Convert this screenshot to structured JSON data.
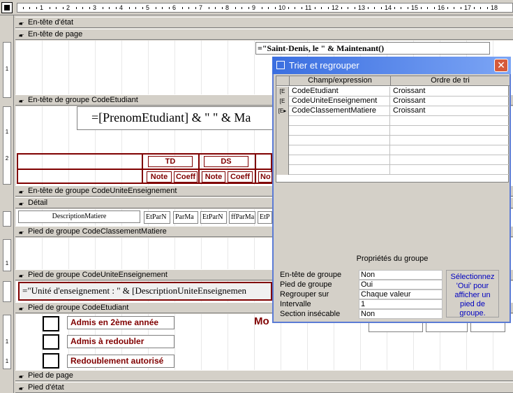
{
  "ruler": {
    "numbers": [
      "1",
      "2",
      "3",
      "4",
      "5",
      "6",
      "7",
      "8",
      "9",
      "10",
      "11",
      "12",
      "13",
      "14",
      "15",
      "16",
      "17",
      "18"
    ]
  },
  "vruler": {
    "marks": [
      "1",
      "1",
      "2",
      "1",
      "1",
      "1"
    ]
  },
  "sections": {
    "report_header": "En-tête d'état",
    "page_header": "En-tête de page",
    "group_header_etudiant": "En-tête de groupe CodeEtudiant",
    "group_header_ue": "En-tête de groupe CodeUniteEnseignement",
    "detail": "Détail",
    "group_footer_classement": "Pied de groupe CodeClassementMatiere",
    "group_footer_ue": "Pied de groupe CodeUniteEnseignement",
    "group_footer_etudiant": "Pied de groupe CodeEtudiant",
    "page_footer": "Pied de page",
    "report_footer": "Pied d'état"
  },
  "controls": {
    "date_expr": "=\"Saint-Denis, le \" & Maintenant()",
    "name_expr": "=[PrenomEtudiant] & \" \" & Ma",
    "td_label": "TD",
    "ds_label": "DS",
    "note1": "Note",
    "coeff1": "Coeff",
    "note2": "Note",
    "coeff2": "Coeff",
    "note3": "No",
    "desc_matiere": "DescriptionMatiere",
    "etpar1": "EtParN",
    "parma1": "ParMa",
    "etpar2": "EtParN",
    "ffparma": "ffParMa",
    "etp3": "EtP",
    "ue_expr": "=\"Unité d'enseignement : \" & [DescriptionUniteEnseignemen",
    "admis2": "Admis en 2ème année",
    "redoubler": "Admis à redoubler",
    "redoublement": "Redoublement autorisé",
    "moy": "Mo"
  },
  "dialog": {
    "title": "Trier et regrouper",
    "close": "✕",
    "col_field": "Champ/expression",
    "col_order": "Ordre de tri",
    "rows": [
      {
        "field": "CodeEtudiant",
        "order": "Croissant"
      },
      {
        "field": "CodeUniteEnseignement",
        "order": "Croissant"
      },
      {
        "field": "CodeClassementMatiere",
        "order": "Croissant"
      }
    ],
    "props_title": "Propriétés du groupe",
    "props": [
      {
        "label": "En-tête de groupe",
        "value": "Non"
      },
      {
        "label": "Pied de groupe",
        "value": "Oui"
      },
      {
        "label": "Regrouper sur",
        "value": "Chaque valeur"
      },
      {
        "label": "Intervalle",
        "value": "1"
      },
      {
        "label": "Section insécable",
        "value": "Non"
      }
    ],
    "help": "Sélectionnez 'Oui' pour afficher un pied de groupe."
  }
}
